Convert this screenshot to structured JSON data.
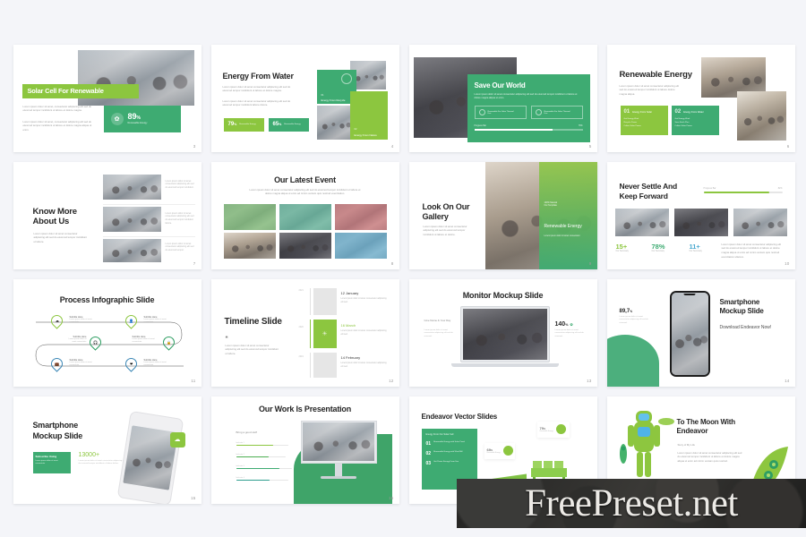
{
  "page": {
    "background_color": "#f4f5f9",
    "accent_green": "#3eab72",
    "accent_light_green": "#8cc63f",
    "accent_teal": "#2f9e63"
  },
  "watermark": {
    "text": "FreePreset.net"
  },
  "lorem": {
    "short": "Lorem ipsum dolor sit amet, consectetur adipiscing elit, sed do eiusmod tempor incididunt ut labore.",
    "medium": "Lorem ipsum dolor sit amet, consectetur adipiscing elit, sed do eiusmod tempor incididunt ut labore et dolore magna aliqua. Ut enim ad minim veniam quis nostrud.",
    "tiny": "Lorem ipsum dolor sit amet",
    "caption": "Lorem ipsum dolor sit amet, consectetur adipiscing elit sed do eiusmod."
  },
  "slides": [
    {
      "number": "3",
      "title": "Solar Cell For Renewable",
      "paragraph1": "Lorem ipsum dolor sit amet, consectetur adipiscing elit sed do eiusmod tempor incididunt ut labore et dolore magna.",
      "paragraph2": "Lorem ipsum dolor sit amet, consectetur adipiscing elit sed do eiusmod tempor incididunt ut labore et dolore magna aliqua ut enim.",
      "stat_value": "89",
      "stat_unit": "%",
      "stat_label": "Renewable Energy",
      "icon": "leaf-icon"
    },
    {
      "number": "4",
      "title": "Energy From Water",
      "paragraph1": "Lorem ipsum dolor sit amet consectetur adipiscing elit sed do eiusmod tempor incididunt ut labore et dolore magna.",
      "paragraph2": "Lorem ipsum dolor sit amet consectetur adipiscing elit sed do eiusmod tempor incididunt labore dolore.",
      "stats": [
        {
          "value": "79",
          "unit": "%",
          "label": "Renewable Energy"
        },
        {
          "value": "65",
          "unit": "%",
          "label": "Renewable Energy"
        }
      ],
      "cards": [
        {
          "num": "01",
          "label": "Energy From Recycle"
        },
        {
          "num": "02",
          "label": "Energy From Nature"
        }
      ],
      "icon": "power-icon"
    },
    {
      "number": "5",
      "title": "Save Our World",
      "paragraph": "Lorem ipsum dolor sit amet consectetur adipiscing elit sed do eiusmod tempor incididunt ut labore et dolore magna aliqua ut enim.",
      "buttons": [
        {
          "label": "Renewable For Solar Thermal Use",
          "icon": "sun-icon"
        },
        {
          "label": "Renewable For Solar Thermal Use",
          "icon": "battery-icon"
        }
      ],
      "progress_label": "Progress Bar",
      "progress_value": "78%",
      "progress_pct": 72
    },
    {
      "number": "6",
      "title": "Renewable Energy",
      "paragraph": "Lorem ipsum dolor sit amet consectetur adipiscing elit sed do eiusmod tempor incididunt ut labore dolore magna aliqua.",
      "cards": [
        {
          "num": "01",
          "heading": "Energy From Solar",
          "bullets": [
            "Get Energy Work",
            "Recycle Power",
            "Collect Solar Power"
          ]
        },
        {
          "num": "02",
          "heading": "Energy From Water",
          "bullets": [
            "Get Energy Work",
            "Save Earth Plan",
            "Collect Solar Power"
          ]
        }
      ]
    },
    {
      "number": "7",
      "title": "Know More About Us",
      "paragraph": "Lorem ipsum dolor sit amet consectetur adipiscing elit sed do eiusmod tempor incididunt ut labore.",
      "items": [
        "Lorem ipsum dolor sit amet consectetur adipiscing elit sed do eiusmod tempor incididunt.",
        "Lorem ipsum dolor sit amet consectetur adipiscing elit sed do eiusmod tempor incididunt labore.",
        "Lorem ipsum dolor sit amet consectetur adipiscing elit sed do eiusmod tempor."
      ]
    },
    {
      "number": "8",
      "title": "Our Latest Event",
      "paragraph": "Lorem ipsum dolor sit amet consectetur adipiscing elit sed do eiusmod tempor incididunt ut labore et dolore magna aliqua ut enim ad minim veniam quis nostrud exercitation.",
      "tiles": [
        "green",
        "teal",
        "red",
        "warm",
        "dark",
        "blue"
      ]
    },
    {
      "number": "9",
      "title": "Look On Our Gallery",
      "paragraph": "Lorem ipsum dolor sit amet consectetur adipiscing elit sed do eiusmod tempor incididunt ut labore et dolore.",
      "overlay_badge": "100% Natural\nOur Template",
      "overlay_title": "Renewable Energy",
      "overlay_sub": "Lorem ipsum dolor sit amet consectetur"
    },
    {
      "number": "10",
      "title": "Never Settle And Keep Forward",
      "progress_label": "Progress Bar",
      "progress_value": "82%",
      "progress_pct": 84,
      "stats": [
        {
          "value": "15+",
          "label": "Our Summary",
          "color": "#8cc63f"
        },
        {
          "value": "78%",
          "label": "Our Summary",
          "color": "#3eab72"
        },
        {
          "value": "11+",
          "label": "Our Summary",
          "color": "#4aa8cf"
        }
      ],
      "paragraph": "Lorem ipsum dolor sit amet consectetur adipiscing elit sed do eiusmod tempor incididunt ut labore et dolore magna aliqua ut enim ad minim veniam quis nostrud exercitation ullamco."
    },
    {
      "number": "11",
      "title": "Process Infographic Slide",
      "nodes": [
        {
          "icon": "cloud-icon",
          "subtitle": "Subtitle Here",
          "desc": "Lorem ipsum dolor sit amet consectetur",
          "color": "#8cc63f"
        },
        {
          "icon": "person-icon",
          "subtitle": "Subtitle Here",
          "desc": "Lorem ipsum dolor sit amet consectetur",
          "color": "#8cc63f"
        },
        {
          "icon": "headset-icon",
          "subtitle": "Subtitle Here",
          "desc": "Lorem ipsum dolor sit amet consectetur",
          "color": "#2f9e63"
        },
        {
          "icon": "lock-icon",
          "subtitle": "Subtitle Here",
          "desc": "Lorem ipsum dolor sit amet consectetur",
          "color": "#2f9e63"
        },
        {
          "icon": "briefcase-icon",
          "subtitle": "Subtitle Here",
          "desc": "Lorem ipsum dolor sit amet consectetur",
          "color": "#3a86b5"
        },
        {
          "icon": "heart-icon",
          "subtitle": "Subtitle Here",
          "desc": "Lorem ipsum dolor sit amet consectetur",
          "color": "#3a86b5"
        }
      ]
    },
    {
      "number": "12",
      "title": "Timeline Slide",
      "quote_mark": "‘‘",
      "paragraph": "Lorem ipsum dolor sit amet consectetur adipiscing elit sed do eiusmod tempor incididunt ut labore.",
      "entries": [
        {
          "year": "2021",
          "date": "12 January",
          "desc": "Lorem ipsum dolor sit amet consectetur adipiscing elit sed.",
          "active": false
        },
        {
          "year": "2020",
          "date": "16 March",
          "desc": "Lorem ipsum dolor sit amet consectetur adipiscing elit sed.",
          "active": true
        },
        {
          "year": "2019",
          "date": "14 February",
          "desc": "Lorem ipsum dolor sit amet consectetur adipiscing elit sed.",
          "active": false
        }
      ]
    },
    {
      "number": "13",
      "title": "Monitor Mockup Slide",
      "left_heading": "Give Name & Your Day",
      "left_text": "Lorem ipsum dolor sit amet consectetur adipiscing elit sed do eiusmod.",
      "stat_value": "140",
      "stat_unit": "%",
      "stat_text": "Lorem ipsum dolor sit amet consectetur adipiscing elit sed do eiusmod."
    },
    {
      "number": "14",
      "title": "Smartphone Mockup Slide",
      "subtitle": "Download Endeavor Now!",
      "stat_value": "89,7",
      "stat_unit": "%",
      "stat_text": "Lorem ipsum dolor sit amet consectetur adipiscing elit sed do eiusmod."
    },
    {
      "number": "15",
      "title": "Smartphone Mockup Slide",
      "badge_title": "Subscribe Using",
      "badge_text": "Lorem ipsum dolor sit amet consectetur",
      "stat_value": "13000+",
      "stat_text": "Lorem ipsum dolor sit amet consectetur adipiscing elit sed do eiusmod tempor incididunt ut labore dolore."
    },
    {
      "number": "16",
      "title": "Our Work Is Presentation",
      "chart_heading": "Bring a good stuff",
      "bars": [
        {
          "label": "Indicator 1",
          "pct": 72,
          "color": "#8cc63f"
        },
        {
          "label": "Indicator 2",
          "pct": 66,
          "color": "#4caf50"
        },
        {
          "label": "Indicator 3",
          "pct": 79,
          "color": "#3eab72"
        },
        {
          "label": "Indicator 4",
          "pct": 64,
          "color": "#2f9e8e"
        }
      ]
    },
    {
      "number": "17",
      "title": "Endeavor Vector Slides",
      "panel_title": "Energy From Our Solar Cell",
      "list": [
        {
          "num": "01",
          "label": "Renewable Energy with Solar Panel"
        },
        {
          "num": "02",
          "label": "Renewable Energy with Wind Mill"
        },
        {
          "num": "03",
          "label": "Get Power Energy From Sun"
        }
      ],
      "badges": [
        {
          "value": "69",
          "unit": "%",
          "label": "Renewable Energy"
        },
        {
          "value": "79",
          "unit": "%",
          "label": "Renewable Energy"
        }
      ]
    },
    {
      "number": "18",
      "title": "To The Moon With Endeavor",
      "subtitle": "Story of My Life",
      "paragraph": "Lorem ipsum dolor sit amet consectetur adipiscing elit sed do eiusmod tempor incididunt ut labore et dolore magna aliqua ut enim ad minim veniam quis nostrud."
    }
  ],
  "chart_data": [
    {
      "type": "bar",
      "title": "Bring a good stuff",
      "categories": [
        "Indicator 1",
        "Indicator 2",
        "Indicator 3",
        "Indicator 4"
      ],
      "values": [
        72,
        66,
        79,
        64
      ],
      "xlabel": "",
      "ylabel": "",
      "ylim": [
        0,
        100
      ],
      "orientation": "horizontal"
    },
    {
      "type": "bar",
      "title": "Never Settle And Keep Forward",
      "categories": [
        "Progress Bar"
      ],
      "values": [
        84
      ],
      "ylim": [
        0,
        100
      ]
    },
    {
      "type": "bar",
      "title": "Save Our World",
      "categories": [
        "Progress Bar"
      ],
      "values": [
        72
      ],
      "ylim": [
        0,
        100
      ]
    }
  ]
}
